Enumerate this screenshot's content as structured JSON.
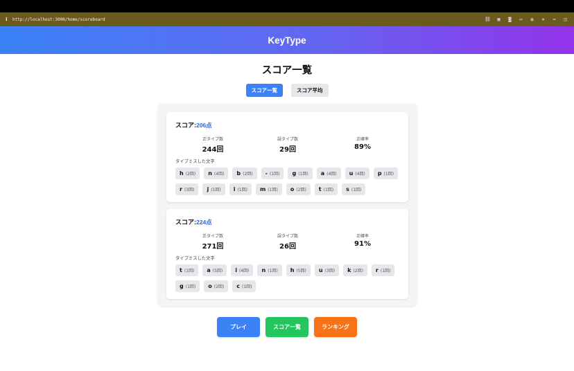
{
  "browser": {
    "url": "http://localhost:3000/home/scoreboard",
    "tool_icons": [
      "link-icon",
      "save-icon",
      "camera-icon",
      "window-icon",
      "globe-icon",
      "gear-icon",
      "split-icon",
      "sidebar-icon"
    ]
  },
  "app": {
    "title": "KeyType"
  },
  "page": {
    "title": "スコア一覧"
  },
  "tabs": [
    {
      "label": "スコア一覧",
      "active": true
    },
    {
      "label": "スコア平均",
      "active": false
    }
  ],
  "labels": {
    "score_prefix": "スコア:",
    "correct": "正タイプ数",
    "wrong": "誤タイプ数",
    "accuracy": "正確率",
    "missed": "タイプミスした文字"
  },
  "scores": [
    {
      "score": "206点",
      "correct": "244回",
      "wrong": "29回",
      "accuracy": "89%",
      "misses": [
        {
          "char": "h",
          "count": "(2回)"
        },
        {
          "char": "n",
          "count": "(4回)"
        },
        {
          "char": "b",
          "count": "(2回)"
        },
        {
          "char": "-",
          "count": "(1回)"
        },
        {
          "char": "g",
          "count": "(1回)"
        },
        {
          "char": "a",
          "count": "(4回)"
        },
        {
          "char": "u",
          "count": "(4回)"
        },
        {
          "char": "p",
          "count": "(1回)"
        },
        {
          "char": "r",
          "count": "(3回)"
        },
        {
          "char": "j",
          "count": "(1回)"
        },
        {
          "char": "i",
          "count": "(1回)"
        },
        {
          "char": "m",
          "count": "(1回)"
        },
        {
          "char": "o",
          "count": "(2回)"
        },
        {
          "char": "t",
          "count": "(1回)"
        },
        {
          "char": "s",
          "count": "(1回)"
        }
      ]
    },
    {
      "score": "224点",
      "correct": "271回",
      "wrong": "26回",
      "accuracy": "91%",
      "misses": [
        {
          "char": "t",
          "count": "(1回)"
        },
        {
          "char": "a",
          "count": "(5回)"
        },
        {
          "char": "i",
          "count": "(4回)"
        },
        {
          "char": "n",
          "count": "(1回)"
        },
        {
          "char": "h",
          "count": "(5回)"
        },
        {
          "char": "u",
          "count": "(3回)"
        },
        {
          "char": "k",
          "count": "(2回)"
        },
        {
          "char": "r",
          "count": "(1回)"
        },
        {
          "char": "g",
          "count": "(1回)"
        },
        {
          "char": "o",
          "count": "(2回)"
        },
        {
          "char": "c",
          "count": "(1回)"
        }
      ]
    }
  ],
  "buttons": [
    {
      "label": "プレイ",
      "color": "#3b82f6",
      "name": "play-button"
    },
    {
      "label": "スコア一覧",
      "color": "#22c55e",
      "name": "scoreboard-button"
    },
    {
      "label": "ランキング",
      "color": "#f97316",
      "name": "ranking-button"
    }
  ]
}
